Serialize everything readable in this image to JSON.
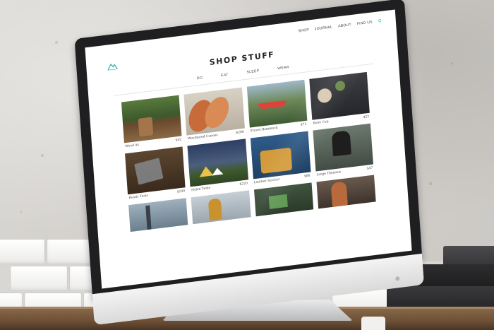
{
  "nav": {
    "items": [
      "SHOP",
      "JOURNAL",
      "ABOUT",
      "FIND US"
    ],
    "search_icon": "search-icon"
  },
  "page": {
    "title": "SHOP STUFF"
  },
  "categories": [
    "DO",
    "EAT",
    "SLEEP",
    "WEAR"
  ],
  "products": [
    {
      "name": "Wood Ax",
      "price": "$42"
    },
    {
      "name": "Weathered Canoes",
      "price": "$200"
    },
    {
      "name": "Travel Hammock",
      "price": "$75"
    },
    {
      "name": "Bone Cup",
      "price": "$22"
    },
    {
      "name": "Rustic Tools",
      "price": "$100"
    },
    {
      "name": "Nylon Tents",
      "price": "$220"
    },
    {
      "name": "Leather Satchel",
      "price": "$80"
    },
    {
      "name": "Large Thermos",
      "price": "$47"
    }
  ],
  "colors": {
    "accent": "#2bb3a3",
    "bezel": "#1f1f22"
  }
}
